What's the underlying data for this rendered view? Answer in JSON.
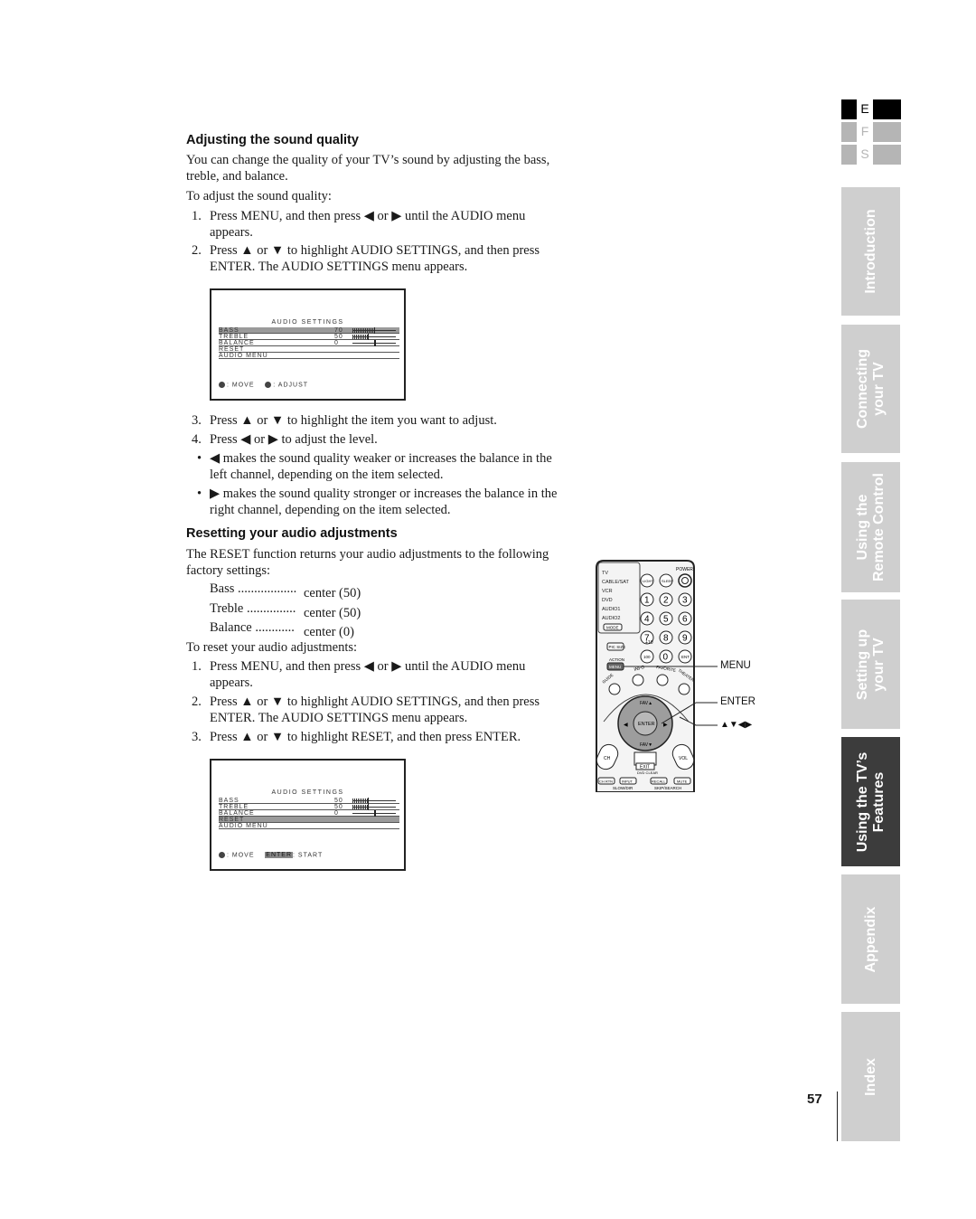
{
  "section1": {
    "heading": "Adjusting the sound quality",
    "intro": "You can change the quality of your TV’s sound by adjusting the bass, treble, and balance.",
    "lead": "To adjust the sound quality:",
    "steps": [
      {
        "num": "1.",
        "text": "Press MENU, and then press ◀ or ▶ until the AUDIO menu appears."
      },
      {
        "num": "2.",
        "text": "Press ▲ or ▼ to highlight AUDIO SETTINGS, and then press ENTER. The AUDIO SETTINGS menu appears."
      },
      {
        "num": "3.",
        "text": "Press ▲ or ▼ to highlight the item you want to adjust."
      },
      {
        "num": "4.",
        "text": "Press ◀ or ▶ to adjust the level."
      }
    ],
    "bullets": [
      {
        "dot": "•",
        "text": "◀ makes the sound quality weaker or increases the balance in the left channel, depending on the item selected."
      },
      {
        "dot": "•",
        "text": "▶ makes the sound quality stronger or increases the balance in the right channel, depending on the item selected."
      }
    ]
  },
  "osd1": {
    "title": "AUDIO SETTINGS",
    "rows": [
      {
        "label": "BASS",
        "value": "70",
        "level": 0.7,
        "highlighted": true,
        "type": "level"
      },
      {
        "label": "TREBLE",
        "value": "50",
        "level": 0.5,
        "highlighted": false,
        "type": "level"
      },
      {
        "label": "BALANCE",
        "value": "0",
        "level": 0.5,
        "highlighted": false,
        "type": "balance"
      },
      {
        "label": "RESET",
        "highlighted": false,
        "type": "none"
      },
      {
        "label": "AUDIO MENU",
        "highlighted": false,
        "type": "none"
      }
    ],
    "footer_move": ": MOVE",
    "footer_action": ": ADJUST"
  },
  "section2": {
    "heading": "Resetting your audio adjustments",
    "intro": "The RESET function returns your audio adjustments to the following factory settings:",
    "factory": [
      {
        "label": "Bass ..................",
        "value": "center (50)"
      },
      {
        "label": "Treble ...............",
        "value": "center (50)"
      },
      {
        "label": "Balance ............",
        "value": "center (0)"
      }
    ],
    "lead": "To reset your audio adjustments:",
    "steps": [
      {
        "num": "1.",
        "text": "Press MENU, and then press ◀ or ▶ until the AUDIO menu appears."
      },
      {
        "num": "2.",
        "text": "Press ▲ or ▼ to highlight AUDIO SETTINGS, and then press ENTER. The AUDIO SETTINGS menu appears."
      },
      {
        "num": "3.",
        "text": "Press ▲ or ▼ to highlight RESET, and then press ENTER."
      }
    ]
  },
  "osd2": {
    "title": "AUDIO SETTINGS",
    "rows": [
      {
        "label": "BASS",
        "value": "50",
        "level": 0.5,
        "highlighted": false,
        "type": "level"
      },
      {
        "label": "TREBLE",
        "value": "50",
        "level": 0.5,
        "highlighted": false,
        "type": "level"
      },
      {
        "label": "BALANCE",
        "value": "0",
        "level": 0.5,
        "highlighted": false,
        "type": "balance"
      },
      {
        "label": "RESET",
        "highlighted": true,
        "type": "none"
      },
      {
        "label": "AUDIO MENU",
        "highlighted": false,
        "type": "none"
      }
    ],
    "footer_move": ": MOVE",
    "footer_enter": "ENTER",
    "footer_action": ": START"
  },
  "remote": {
    "mode_labels": [
      "TV",
      "CABLE/SAT",
      "VCR",
      "DVD",
      "AUDIO1",
      "AUDIO2"
    ],
    "mode_button": "MODE",
    "power": "POWER",
    "light": "LIGHT",
    "sleep": "SLEEP",
    "digits": [
      "1",
      "2",
      "3",
      "4",
      "5",
      "6",
      "7",
      "8",
      "9"
    ],
    "pic_size": "PIC SIZE",
    "plus10": "+10",
    "hundred": "100",
    "zero": "0",
    "ent": "ENT",
    "action": "ACTION",
    "menu": "MENU",
    "info": "INFO",
    "favorite": "FAVORITE",
    "theater": "THEATER",
    "guide": "GUIDE",
    "enter": "ENTER",
    "fav_up": "FAV▲",
    "fav_down": "FAV▼",
    "ch": "CH",
    "vol": "VOL",
    "exit": "EXIT",
    "dvd_clear": "DVD CLEAR",
    "ch_rtn": "CH RTN",
    "input": "INPUT",
    "recall": "RECALL",
    "mute": "MUTE",
    "slow_dir": "SLOW/DIR",
    "skip_search": "SKIP/SEARCH"
  },
  "callouts": {
    "menu": "MENU",
    "enter": "ENTER",
    "arrows": "▲▼◀▶"
  },
  "sidebar": {
    "languages": [
      {
        "letter": "E",
        "active": true
      },
      {
        "letter": "F",
        "active": false
      },
      {
        "letter": "S",
        "active": false
      }
    ],
    "tabs": [
      {
        "label": "Introduction",
        "active": false
      },
      {
        "label": "Connecting\nyour TV",
        "active": false
      },
      {
        "label": "Using the\nRemote Control",
        "active": false
      },
      {
        "label": "Setting up\nyour TV",
        "active": false
      },
      {
        "label": "Using the TV’s\nFeatures",
        "active": true
      },
      {
        "label": "Appendix",
        "active": false
      },
      {
        "label": "Index",
        "active": false
      }
    ]
  },
  "page_number": "57",
  "colors": {
    "tab_inactive": "#cfcfcf",
    "tab_active": "#3c3c3c",
    "osd_highlight": "#9a9a9a"
  }
}
